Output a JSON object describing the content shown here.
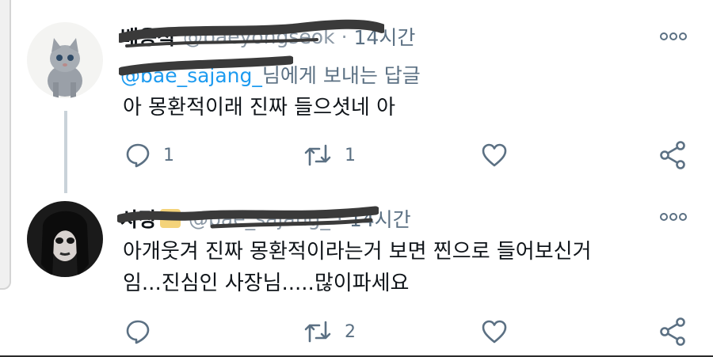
{
  "tweets": [
    {
      "display_name": "배용석",
      "handle": "@baeyongseok",
      "separator": "·",
      "time": "14시간",
      "reply_to_handle": "@bae_sajang_",
      "reply_to_suffix": "님에게 보내는 답글",
      "text": "아 몽환적이래 진짜 들으셧네 아",
      "reply_count": "1",
      "retweet_count": "1",
      "like_count": ""
    },
    {
      "display_name": "사장",
      "handle": "@bae_sajang_",
      "separator": "·",
      "time": "14시간",
      "text": "아개웃겨 진짜 몽환적이라는거 보면 찐으로 들어보신거\n임...진심인 사장님.....많이파세요",
      "reply_count": "",
      "retweet_count": "2",
      "like_count": ""
    }
  ],
  "colors": {
    "accent": "#1d9bf0",
    "secondary_text": "#5b7083",
    "icon": "#5b7083",
    "redaction": "#3a3a3a"
  },
  "icons": {
    "avatar_1": "grey-kitten-photo",
    "avatar_2": "goth-portrait-photo",
    "more": "more-dots-icon",
    "reply": "reply-bubble-icon",
    "retweet": "retweet-icon",
    "like": "heart-icon",
    "share": "share-icon"
  }
}
